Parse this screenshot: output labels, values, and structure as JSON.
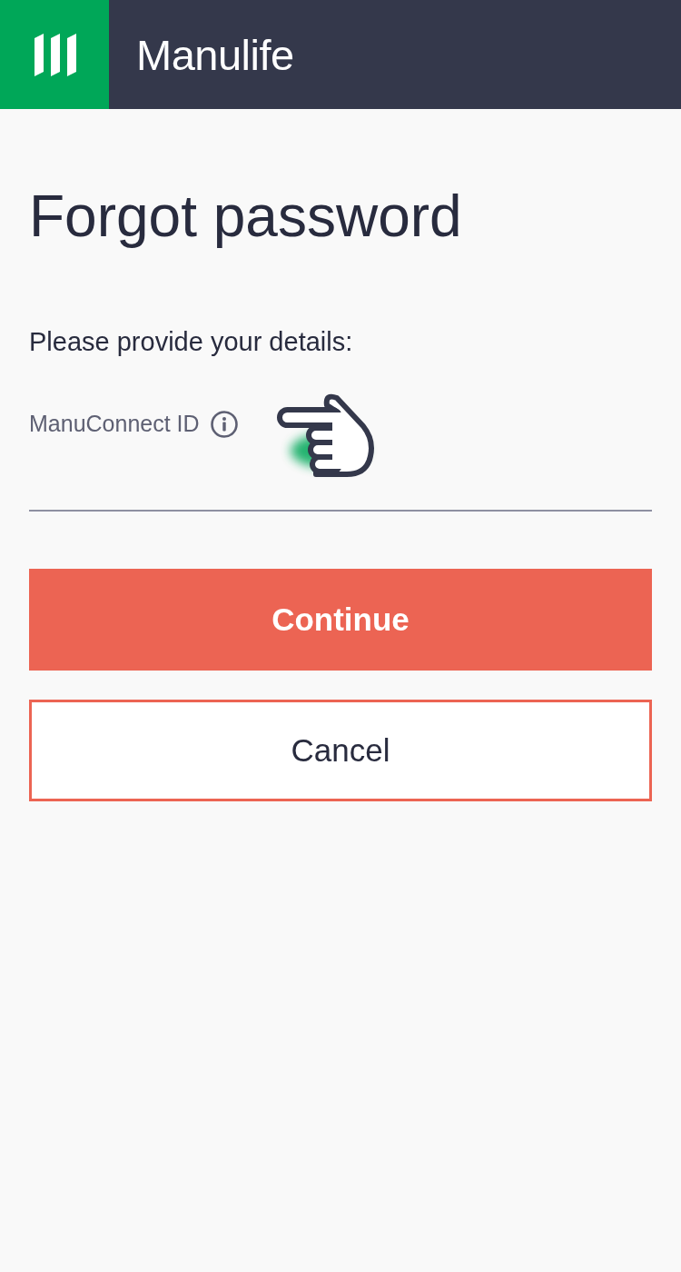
{
  "header": {
    "brand": "Manulife"
  },
  "title": "Forgot password",
  "intro": "Please provide your details:",
  "field": {
    "label": "ManuConnect ID",
    "info_icon": true,
    "pointer_hint": true
  },
  "buttons": [
    {
      "label": "Continue",
      "kind": "primary"
    },
    {
      "label": "Cancel",
      "kind": "secondary"
    }
  ]
}
